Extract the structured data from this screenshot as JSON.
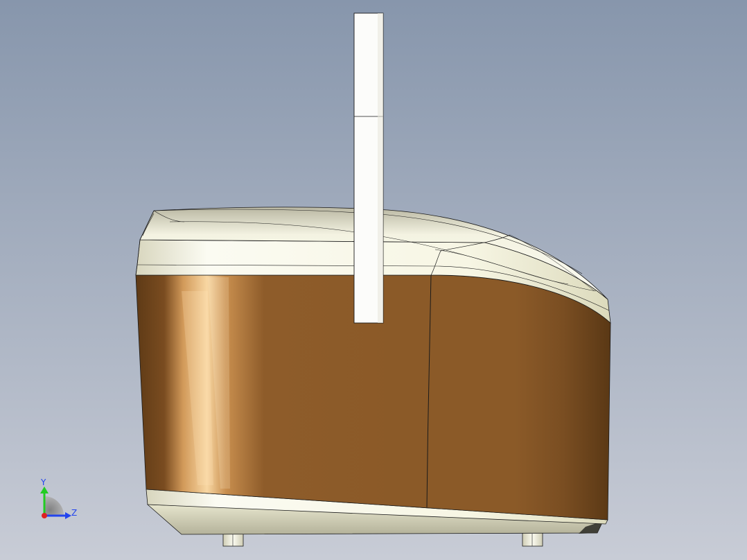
{
  "viewport": {
    "background_top": "#8796ac",
    "background_bottom": "#c8ccd6"
  },
  "model": {
    "body_color": "#8b5a28",
    "trim_color": "#f7f6e4",
    "outline_color": "#1a1a1a"
  },
  "triad": {
    "y_label": "Y",
    "z_label": "Z",
    "y_color": "#22cc22",
    "z_color": "#2244ee",
    "x_color": "#dd2222"
  }
}
